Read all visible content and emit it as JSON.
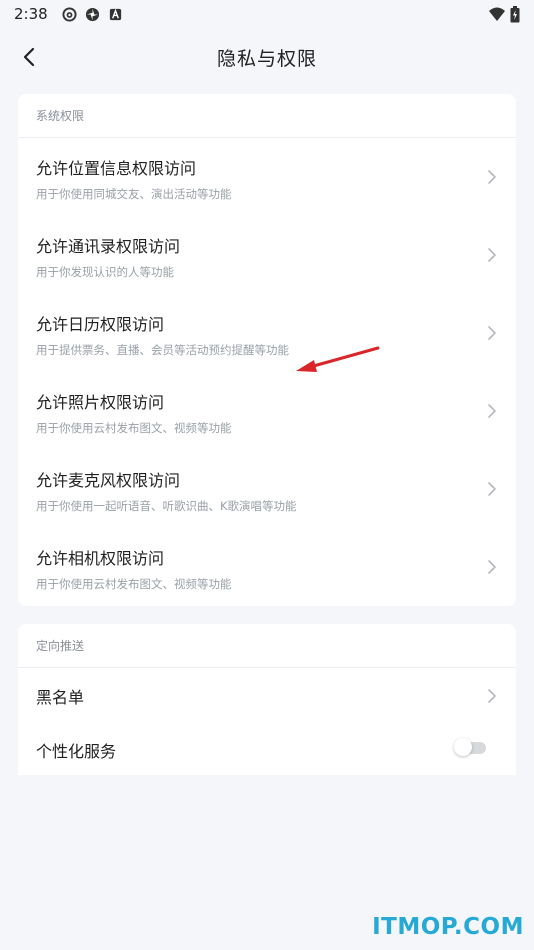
{
  "status_bar": {
    "time": "2:38",
    "icons": [
      "netease-music-icon",
      "pinwheel-icon",
      "app-a-icon"
    ],
    "right_icons": [
      "wifi-icon",
      "battery-icon"
    ]
  },
  "header": {
    "title": "隐私与权限",
    "back_icon": "chevron-left-icon"
  },
  "system_permissions": {
    "header": "系统权限",
    "items": [
      {
        "title": "允许位置信息权限访问",
        "subtitle": "用于你使用同城交友、演出活动等功能"
      },
      {
        "title": "允许通讯录权限访问",
        "subtitle": "用于你发现认识的人等功能"
      },
      {
        "title": "允许日历权限访问",
        "subtitle": "用于提供票务、直播、会员等活动预约提醒等功能"
      },
      {
        "title": "允许照片权限访问",
        "subtitle": "用于你使用云村发布图文、视频等功能"
      },
      {
        "title": "允许麦克风权限访问",
        "subtitle": "用于你使用一起听语音、听歌识曲、K歌演唱等功能"
      },
      {
        "title": "允许相机权限访问",
        "subtitle": "用于你使用云村发布图文、视频等功能"
      }
    ]
  },
  "targeted_push": {
    "header": "定向推送",
    "blacklist": "黑名单",
    "personalized_service": "个性化服务",
    "personalized_service_enabled": false
  },
  "colors": {
    "background": "#f4f6f9",
    "card": "#ffffff",
    "annotation_arrow": "#d9262a",
    "watermark": "#27a9d6"
  },
  "watermark": "ITMOP.COM"
}
